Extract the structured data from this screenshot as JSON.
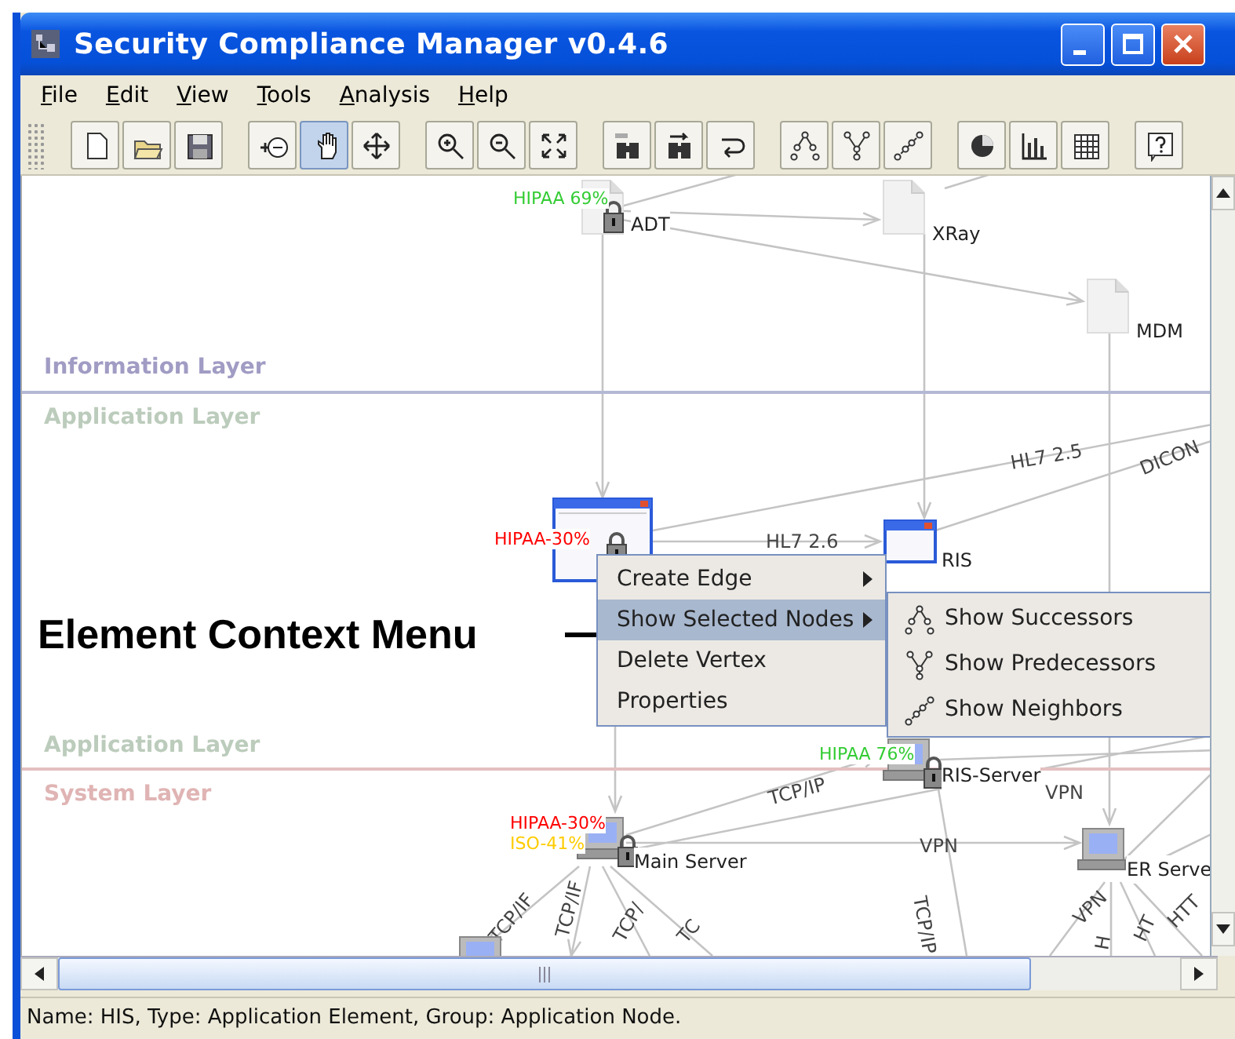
{
  "window": {
    "title": "Security Compliance Manager v0.4.6"
  },
  "menu": [
    "File",
    "Edit",
    "View",
    "Tools",
    "Analysis",
    "Help"
  ],
  "toolbar": [
    [
      {
        "kind": "new",
        "selected": false
      },
      {
        "kind": "open",
        "selected": false
      },
      {
        "kind": "save",
        "selected": false
      }
    ],
    [
      {
        "kind": "connect",
        "selected": false
      },
      {
        "kind": "hand",
        "selected": true
      },
      {
        "kind": "move",
        "selected": false
      }
    ],
    [
      {
        "kind": "zoom-in",
        "selected": false
      },
      {
        "kind": "zoom-out",
        "selected": false
      },
      {
        "kind": "fit",
        "selected": false
      }
    ],
    [
      {
        "kind": "find",
        "selected": false
      },
      {
        "kind": "find-next",
        "selected": false
      },
      {
        "kind": "undo",
        "selected": false
      }
    ],
    [
      {
        "kind": "successors",
        "selected": false
      },
      {
        "kind": "predecessors",
        "selected": false
      },
      {
        "kind": "neighbors",
        "selected": false
      }
    ],
    [
      {
        "kind": "pie",
        "selected": false
      },
      {
        "kind": "bar",
        "selected": false
      },
      {
        "kind": "table",
        "selected": false
      }
    ],
    [
      {
        "kind": "help",
        "selected": false
      }
    ]
  ],
  "layer_labels": [
    {
      "text": "Information Layer",
      "color": "#a09cc4"
    },
    {
      "text": "Application Layer",
      "color": "#bcccbc"
    },
    {
      "text": "Application Layer",
      "color": "#bcccbc"
    },
    {
      "text": "System Layer",
      "color": "#e0b4b4"
    }
  ],
  "nodes": [
    {
      "kind": "document",
      "label": "ADT",
      "locked": true,
      "tags": [
        {
          "text": "HIPAA 69%",
          "color": "#33cc33"
        }
      ]
    },
    {
      "kind": "document",
      "label": "XRay"
    },
    {
      "kind": "document",
      "label": "MDM"
    },
    {
      "kind": "app",
      "locked": true,
      "tags": [
        {
          "text": "HIPAA-30%",
          "color": "#ff0000"
        }
      ]
    },
    {
      "kind": "app",
      "label": "RIS"
    },
    {
      "kind": "server",
      "label": "RIS-Server",
      "locked": true,
      "tags": [
        {
          "text": "HIPAA 76%",
          "color": "#33cc33"
        }
      ]
    },
    {
      "kind": "server",
      "label": "Main Server",
      "locked": true,
      "tags": [
        {
          "text": "HIPAA-30%",
          "color": "#ff0000"
        },
        {
          "text": "ISO-41%",
          "color": "#ffcc00"
        }
      ]
    },
    {
      "kind": "server",
      "label": "ER Serve"
    },
    {
      "kind": "server"
    }
  ],
  "edge_labels": [
    "HL7 2.5",
    "DICON",
    "HL7 2.6",
    "TCP/IP",
    "VPN",
    "VPN",
    "TCP/IP",
    "TCP/IF",
    "TCP/IF",
    "TCP/",
    "TC",
    "VPN",
    "H",
    "HT",
    "HTT"
  ],
  "context_menu": [
    {
      "label": "Create Edge",
      "submenu": true,
      "selected": false
    },
    {
      "label": "Show Selected Nodes",
      "submenu": true,
      "selected": true
    },
    {
      "label": "Delete Vertex",
      "submenu": false,
      "selected": false
    },
    {
      "label": "Properties",
      "submenu": false,
      "selected": false
    }
  ],
  "submenu": [
    {
      "kind": "successors",
      "label": "Show Successors"
    },
    {
      "kind": "predecessors",
      "label": "Show Predecessors"
    },
    {
      "kind": "neighbors",
      "label": "Show Neighbors"
    }
  ],
  "annotation": "Element Context Menu",
  "status_bar": "Name: HIS, Type: Application Element, Group: Application Node."
}
